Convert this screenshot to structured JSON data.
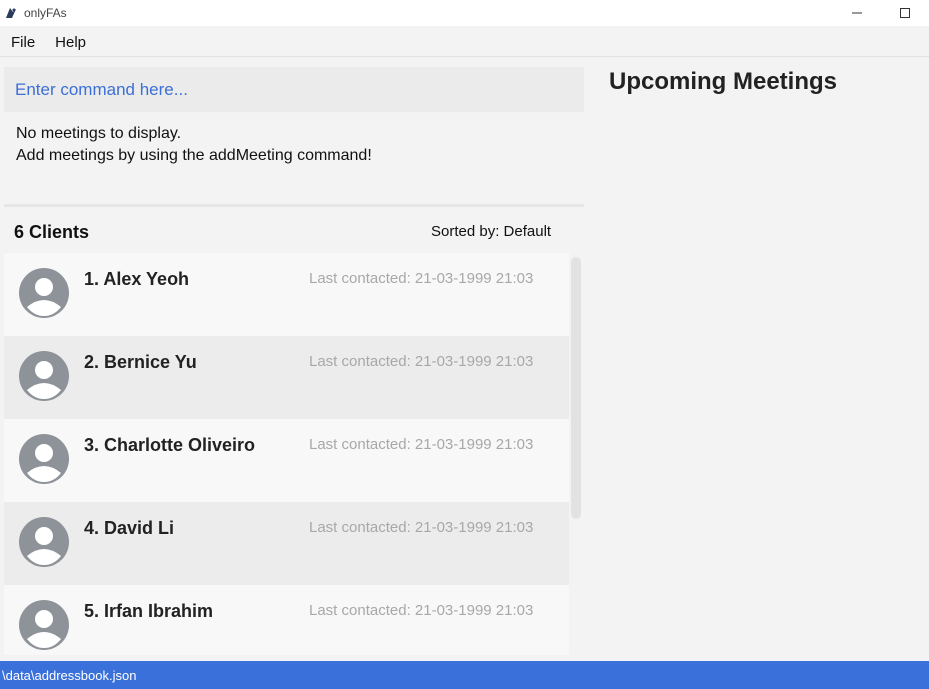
{
  "window": {
    "title": "onlyFAs",
    "icon": "app-logo-icon",
    "minimize_label": "—",
    "maximize_label": "☐"
  },
  "menu": {
    "items": [
      {
        "label": "File"
      },
      {
        "label": "Help"
      }
    ]
  },
  "command": {
    "placeholder": "Enter command here...",
    "value": ""
  },
  "result": {
    "line1": "No meetings to display.",
    "line2": "Add meetings by using the addMeeting command!"
  },
  "clients": {
    "header": "6 Clients",
    "sort_label": "Sorted by: Default",
    "items": [
      {
        "name": "1.  Alex Yeoh",
        "last_contacted": "Last contacted: 21-03-1999 21:03"
      },
      {
        "name": "2.  Bernice Yu",
        "last_contacted": "Last contacted: 21-03-1999 21:03"
      },
      {
        "name": "3.  Charlotte Oliveiro",
        "last_contacted": "Last contacted: 21-03-1999 21:03"
      },
      {
        "name": "4.  David Li",
        "last_contacted": "Last contacted: 21-03-1999 21:03"
      },
      {
        "name": "5.  Irfan Ibrahim",
        "last_contacted": "Last contacted: 21-03-1999 21:03"
      }
    ]
  },
  "meetings": {
    "title": "Upcoming Meetings"
  },
  "status": {
    "path": "\\data\\addressbook.json"
  },
  "colors": {
    "accent": "#3a70d9",
    "placeholder": "#3c6fd8",
    "avatar": "#8e9299"
  }
}
